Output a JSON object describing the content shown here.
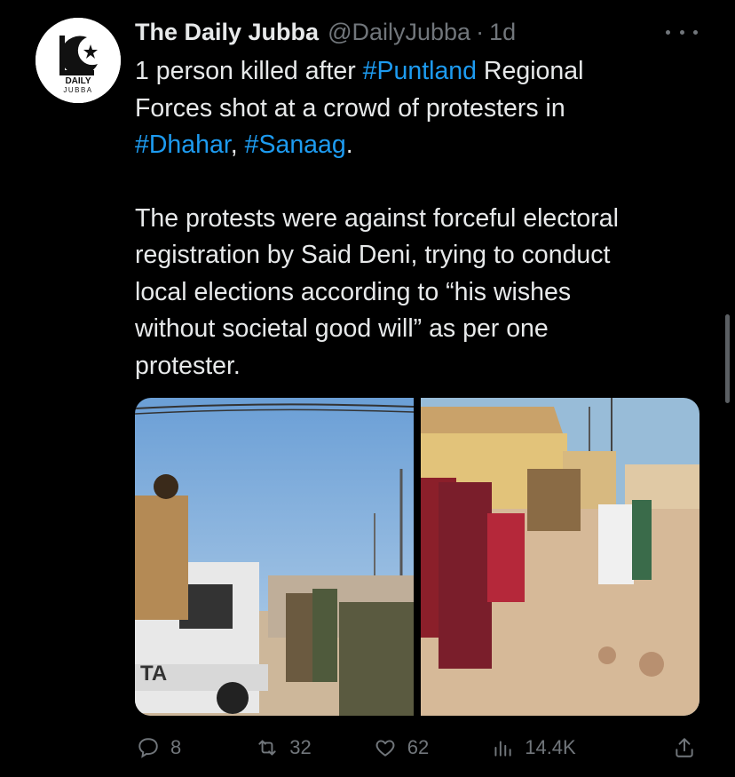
{
  "tweet": {
    "author_name": "The Daily Jubba",
    "author_handle": "@DailyJubba",
    "separator": "·",
    "time": "1d",
    "logo_text_top": "DAILY",
    "logo_text_bottom": "JUBBA",
    "paragraph1": [
      {
        "text": "1 person killed after ",
        "hashtag": false
      },
      {
        "text": "#Puntland",
        "hashtag": true
      },
      {
        "text": " Regional",
        "hashtag": false
      }
    ],
    "line2": "Forces shot at a crowd of protesters in",
    "line3": [
      {
        "text": "#Dhahar",
        "hashtag": true
      },
      {
        "text": ", ",
        "hashtag": false
      },
      {
        "text": "#Sanaag",
        "hashtag": true
      },
      {
        "text": ".",
        "hashtag": false
      }
    ],
    "paragraph2_lines": [
      "The protests were against forceful electoral",
      "registration by Said Deni, trying to conduct",
      "local elections according to “his wishes",
      "without societal good will” as per one",
      "protester."
    ],
    "media_left_plate": "TA"
  },
  "actions": {
    "reply_count": "8",
    "retweet_count": "32",
    "like_count": "62",
    "views_count": "14.4K"
  },
  "colors": {
    "background": "#000000",
    "text": "#e7e9ea",
    "muted": "#71767b",
    "accent": "#1d9bf0"
  },
  "icons": [
    "more-icon",
    "reply-icon",
    "retweet-icon",
    "like-icon",
    "views-icon",
    "share-icon"
  ]
}
